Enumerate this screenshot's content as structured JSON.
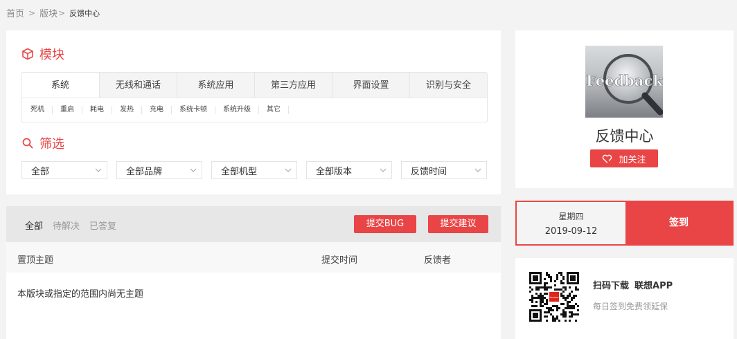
{
  "breadcrumb": {
    "home": "首页",
    "sep1": ">",
    "section": "版块",
    "sep2": ">",
    "current": "反馈中心"
  },
  "module": {
    "title": "模块",
    "tabs": [
      "系统",
      "无线和通话",
      "系统应用",
      "第三方应用",
      "界面设置",
      "识别与安全"
    ],
    "subtags": [
      "死机",
      "重启",
      "耗电",
      "发热",
      "充电",
      "系统卡顿",
      "系统升级",
      "其它"
    ]
  },
  "filter": {
    "title": "筛选",
    "selects": [
      "全部",
      "全部品牌",
      "全部机型",
      "全部版本",
      "反馈时间"
    ]
  },
  "list": {
    "tabs": [
      "全部",
      "待解决",
      "已答复"
    ],
    "btn_bug": "提交BUG",
    "btn_suggest": "提交建议",
    "col_topic": "置顶主题",
    "col_time": "提交时间",
    "col_user": "反馈者",
    "empty": "本版块或指定的范围内尚无主题"
  },
  "profile": {
    "image_text": "Feedback",
    "name": "反馈中心",
    "follow": "加关注"
  },
  "sign": {
    "weekday": "星期四",
    "date": "2019-09-12",
    "button": "签到"
  },
  "app": {
    "title_a": "扫码下载",
    "title_b": "联想APP",
    "subtitle": "每日签到免费领延保",
    "qr_logo": "Lenovo"
  },
  "colors": {
    "accent": "#e94546",
    "bg": "#f3f3f3"
  }
}
